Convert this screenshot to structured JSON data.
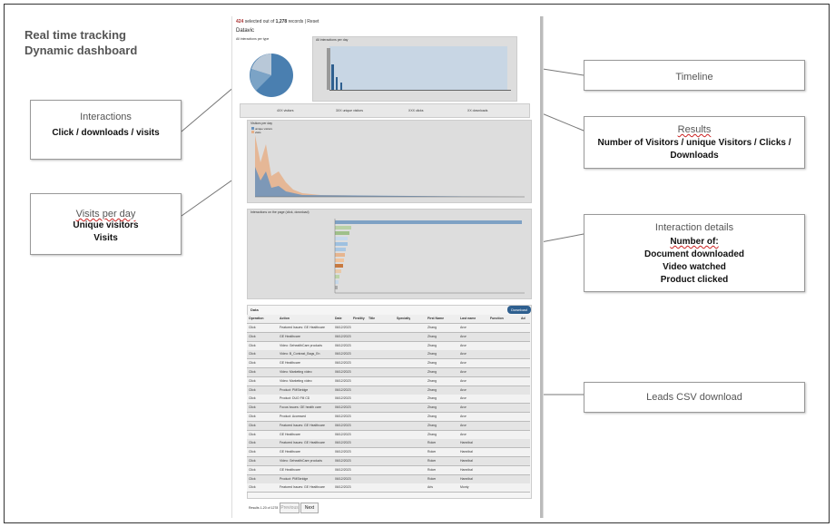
{
  "header": {
    "line1": "Real time tracking",
    "line2": "Dynamic dashboard"
  },
  "callouts": [
    {
      "key": "interactions",
      "title": "Interactions",
      "body": [
        "Click / downloads / visits"
      ]
    },
    {
      "key": "visits",
      "title": "Visits per day",
      "body": [
        "Unique visitors",
        "Visits"
      ]
    },
    {
      "key": "timeline",
      "title": "Timeline",
      "body": []
    },
    {
      "key": "results",
      "title": "Results",
      "body": [
        "Number of Visitors / unique Visitors / Clicks / Downloads"
      ]
    },
    {
      "key": "details",
      "title": "Interaction details",
      "body": [
        "Number of:",
        "Document downloaded",
        "Video watched",
        "Product clicked"
      ]
    },
    {
      "key": "leads",
      "title": "Leads  CSV download",
      "body": []
    }
  ],
  "dashboard": {
    "selected_count": "424",
    "selected_text": "selected out of",
    "total_records": "1,278",
    "records_reset": "records | Reset",
    "title": "Datavic",
    "pie_title": "All interactions per type",
    "timeline_title": "All interactions per day",
    "stats": [
      "4XX visitors",
      "3XX unique visitors",
      "XXX clicks",
      "XX downloads"
    ],
    "visits_title": "Visitors per day",
    "legend": [
      "unique visitors",
      "visits"
    ],
    "bars_title": "Interactions on the page (click, download)",
    "data_title": "Data",
    "download_label": "Download",
    "columns": [
      "Operation",
      "Action",
      "Date",
      "Firstlity",
      "Title",
      "Specialty",
      "First Name",
      "Last name",
      "Function",
      "Ad"
    ],
    "rows": [
      {
        "op": "Click",
        "action": "Featured Issues: GE Healthcare",
        "date": "06/12/2023",
        "first": "Zhang",
        "last": "Aron"
      },
      {
        "op": "Click",
        "action": "GE Healthcare",
        "date": "06/12/2023",
        "first": "Zhang",
        "last": "Aron"
      },
      {
        "op": "Click",
        "action": "Video: GehealthCare products",
        "date": "06/12/2023",
        "first": "Zhang",
        "last": "Aron"
      },
      {
        "op": "Click",
        "action": "Video: B_Contrast_Bags_En",
        "date": "06/12/2023",
        "first": "Zhang",
        "last": "Aron"
      },
      {
        "op": "Click",
        "action": "GE Healthcare",
        "date": "06/12/2023",
        "first": "Zhang",
        "last": "Aron"
      },
      {
        "op": "Click",
        "action": "Video: Marketing video",
        "date": "06/12/2023",
        "first": "Zhang",
        "last": "Aron"
      },
      {
        "op": "Click",
        "action": "Video: Marketing video",
        "date": "06/12/2023",
        "first": "Zhang",
        "last": "Aron"
      },
      {
        "op": "Click",
        "action": "Product: PMSbridge",
        "date": "06/12/2023",
        "first": "Zhang",
        "last": "Aron"
      },
      {
        "op": "Click",
        "action": "Product: DUO Fill CD",
        "date": "06/12/2023",
        "first": "Zhang",
        "last": "Aron"
      },
      {
        "op": "Click",
        "action": "Focus Issues: GE health care",
        "date": "06/12/2023",
        "first": "Zhang",
        "last": "Aron"
      },
      {
        "op": "Click",
        "action": "Product: Accessed",
        "date": "06/12/2023",
        "first": "Zhang",
        "last": "Aron"
      },
      {
        "op": "Click",
        "action": "Featured Issues: GE Healthcare",
        "date": "06/12/2023",
        "first": "Zhang",
        "last": "Aron"
      },
      {
        "op": "Click",
        "action": "GE Healthcare",
        "date": "06/12/2023",
        "first": "Zhang",
        "last": "Aron"
      },
      {
        "op": "Click",
        "action": "Featured Issues: GE Healthcare",
        "date": "06/12/2023",
        "first": "Roker",
        "last": "Hannibal"
      },
      {
        "op": "Click",
        "action": "GE Healthcare",
        "date": "06/12/2023",
        "first": "Roker",
        "last": "Hannibal"
      },
      {
        "op": "Click",
        "action": "Video: GehealthCare products",
        "date": "06/12/2023",
        "first": "Roker",
        "last": "Hannibal"
      },
      {
        "op": "Click",
        "action": "GE Healthcare",
        "date": "06/12/2023",
        "first": "Roker",
        "last": "Hannibal"
      },
      {
        "op": "Click",
        "action": "Product: PMSbridge",
        "date": "06/12/2023",
        "first": "Roker",
        "last": "Hannibal"
      },
      {
        "op": "Click",
        "action": "Featured Issues: GE Healthcare",
        "date": "06/12/2023",
        "first": "Aris",
        "last": "Monty"
      }
    ],
    "pagination_text": "Results 1-20 of 1278",
    "prev_label": "Previous",
    "next_label": "Next"
  }
}
